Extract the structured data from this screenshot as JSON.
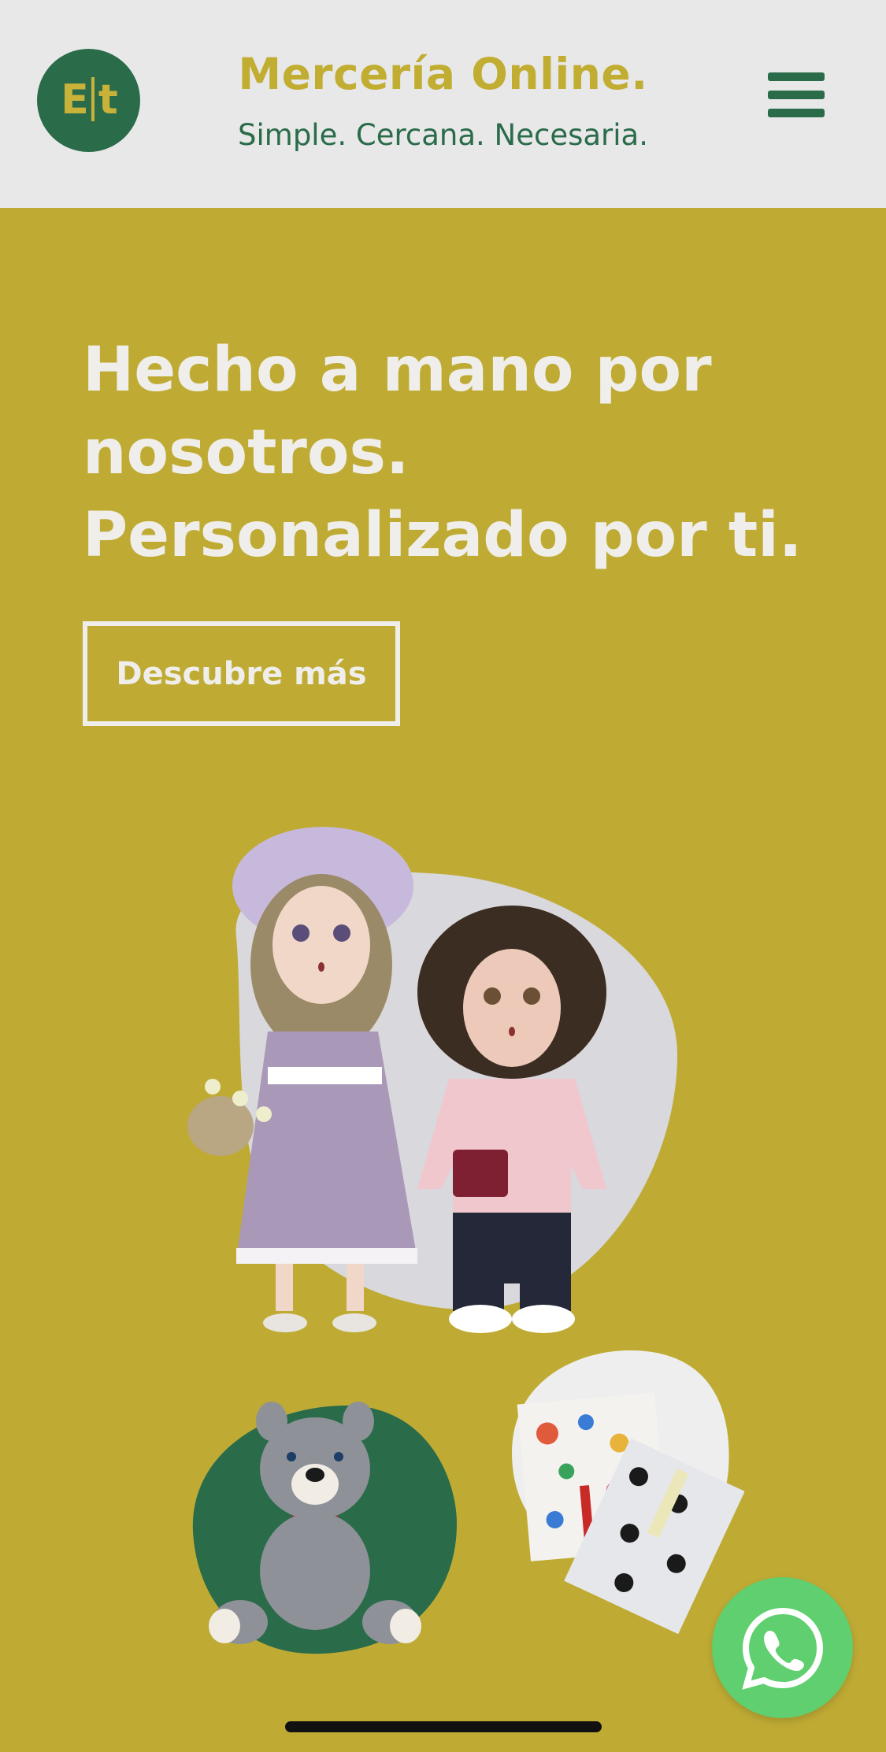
{
  "header": {
    "logo_text": "E|t",
    "title": "Mercería Online.",
    "subtitle": "Simple. Cercana. Necesaria."
  },
  "hero": {
    "title_lines": [
      "Hecho a mano por",
      "nosotros.",
      "Personalizado por ti."
    ],
    "cta_label": "Descubre más"
  },
  "icons": {
    "menu": "hamburger-icon",
    "whatsapp": "whatsapp-icon"
  },
  "colors": {
    "brand_olive": "#bfab34",
    "brand_green": "#2a6b4a",
    "header_bg": "#e8e8e8",
    "whatsapp_green": "#5fcf6f"
  }
}
